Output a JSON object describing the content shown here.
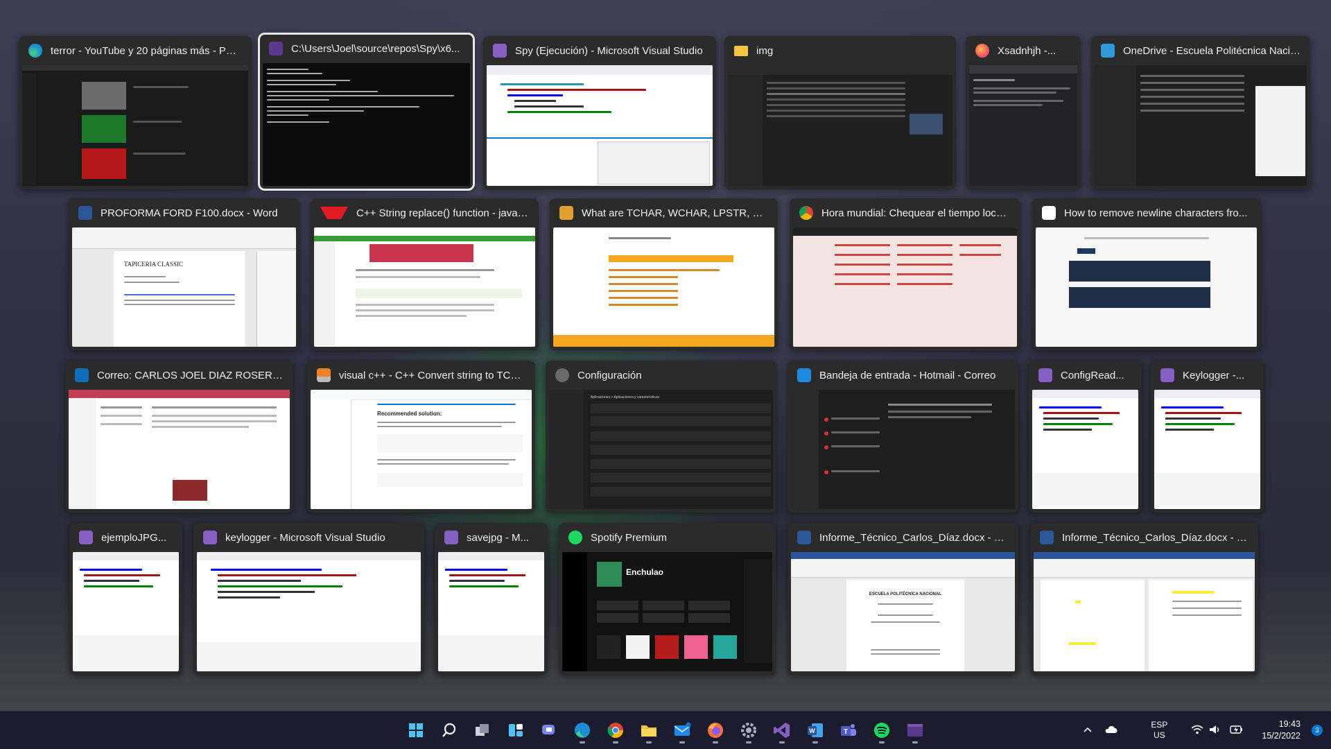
{
  "windows": [
    {
      "title": "terror - YouTube y 20 páginas más - Per...",
      "icon": "edge-icon",
      "theme": "dark"
    },
    {
      "title": "C:\\Users\\Joel\\source\\repos\\Spy\\x6...",
      "icon": "console-icon",
      "theme": "dark"
    },
    {
      "title": "Spy (Ejecución) - Microsoft Visual Studio",
      "icon": "visual-studio-icon",
      "theme": "light"
    },
    {
      "title": "img",
      "icon": "folder-icon",
      "theme": "dark"
    },
    {
      "title": "Xsadnhjh -...",
      "icon": "firefox-icon",
      "theme": "dark"
    },
    {
      "title": "OneDrive - Escuela Politécnica Nacio...",
      "icon": "file-explorer-icon",
      "theme": "light"
    },
    {
      "title": "PROFORMA FORD F100.docx - Word",
      "icon": "word-icon",
      "theme": "light"
    },
    {
      "title": "C++ String replace() function - javatpoint",
      "icon": "javatpoint-icon",
      "theme": "light"
    },
    {
      "title": "What are TCHAR, WCHAR, LPSTR, LPWS...",
      "icon": "site-icon",
      "theme": "light"
    },
    {
      "title": "Hora mundial: Chequear el tiempo local al...",
      "icon": "chrome-icon",
      "theme": "dark"
    },
    {
      "title": "How to remove newline characters fro...",
      "icon": "page-icon",
      "theme": "light"
    },
    {
      "title": "Correo: CARLOS JOEL DIAZ ROSERO - O...",
      "icon": "outlook-icon",
      "theme": "light"
    },
    {
      "title": "visual c++ - C++ Convert string to TCH...",
      "icon": "stackoverflow-icon",
      "theme": "light"
    },
    {
      "title": "Configuración",
      "icon": "settings-icon",
      "theme": "dark"
    },
    {
      "title": "Bandeja de entrada - Hotmail - Correo",
      "icon": "mail-icon",
      "theme": "dark"
    },
    {
      "title": "ConfigRead...",
      "icon": "visual-studio-icon",
      "theme": "light"
    },
    {
      "title": "Keylogger -...",
      "icon": "visual-studio-icon",
      "theme": "light"
    },
    {
      "title": "ejemploJPG...",
      "icon": "visual-studio-icon",
      "theme": "light"
    },
    {
      "title": "keylogger - Microsoft Visual Studio",
      "icon": "visual-studio-icon",
      "theme": "light"
    },
    {
      "title": "savejpg - M...",
      "icon": "visual-studio-icon",
      "theme": "light"
    },
    {
      "title": "Spotify Premium",
      "icon": "spotify-icon",
      "theme": "dark"
    },
    {
      "title": "Informe_Técnico_Carlos_Díaz.docx - Re...",
      "icon": "word-icon",
      "theme": "light"
    },
    {
      "title": "Informe_Técnico_Carlos_Díaz.docx - Word",
      "icon": "word-icon",
      "theme": "light"
    }
  ],
  "thumb_text": {
    "spotify_playlist": "Enchulao",
    "word_doc_heading": "TAPICERIA CLASSIC",
    "so_solution": "Recommended solution:",
    "report_school": "ESCUELA POLITÉCNICA NACIONAL",
    "settings_header": "Aplicaciones > Aplicaciones y características"
  },
  "taskbar": {
    "apps": [
      "start-icon",
      "search-icon",
      "task-view-icon",
      "widgets-icon",
      "teams-chat-icon",
      "edge-icon",
      "chrome-icon",
      "file-explorer-icon",
      "mail-icon",
      "firefox-icon",
      "settings-icon",
      "visual-studio-icon",
      "word-icon",
      "teams-icon",
      "spotify-icon",
      "console-icon"
    ],
    "language_top": "ESP",
    "language_bottom": "US",
    "time": "19:43",
    "date": "15/2/2022",
    "notification_count": "3"
  },
  "colors": {
    "accent": "#0078d4",
    "vs_purple": "#865fc5",
    "spotify_green": "#1ed760",
    "word_blue": "#2b579a"
  }
}
